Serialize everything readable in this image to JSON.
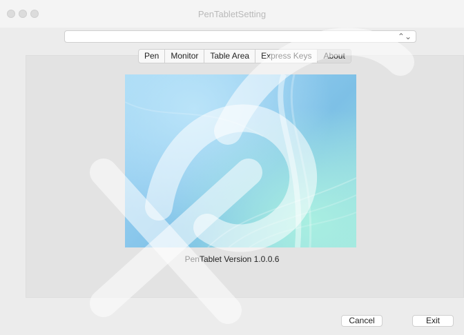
{
  "window": {
    "title": "PenTabletSetting"
  },
  "device_select": {
    "value": "",
    "chevron": "up-down-chevron-icon"
  },
  "tabs": [
    {
      "label": "Pen",
      "active": false
    },
    {
      "label": "Monitor",
      "active": false
    },
    {
      "label": "Table Area",
      "active": false
    },
    {
      "label": "Express Keys",
      "active": false
    },
    {
      "label": "About",
      "active": true
    }
  ],
  "about": {
    "image": "abstract-blue-wave-background",
    "version_text": "PenTablet Version  1.0.0.6"
  },
  "footer": {
    "cancel_label": "Cancel",
    "exit_label": "Exit"
  },
  "colors": {
    "window_bg": "#ececec",
    "panel_bg": "#e3e3e3",
    "image_blue": "#8fcaee",
    "image_teal": "#9ee3df"
  }
}
